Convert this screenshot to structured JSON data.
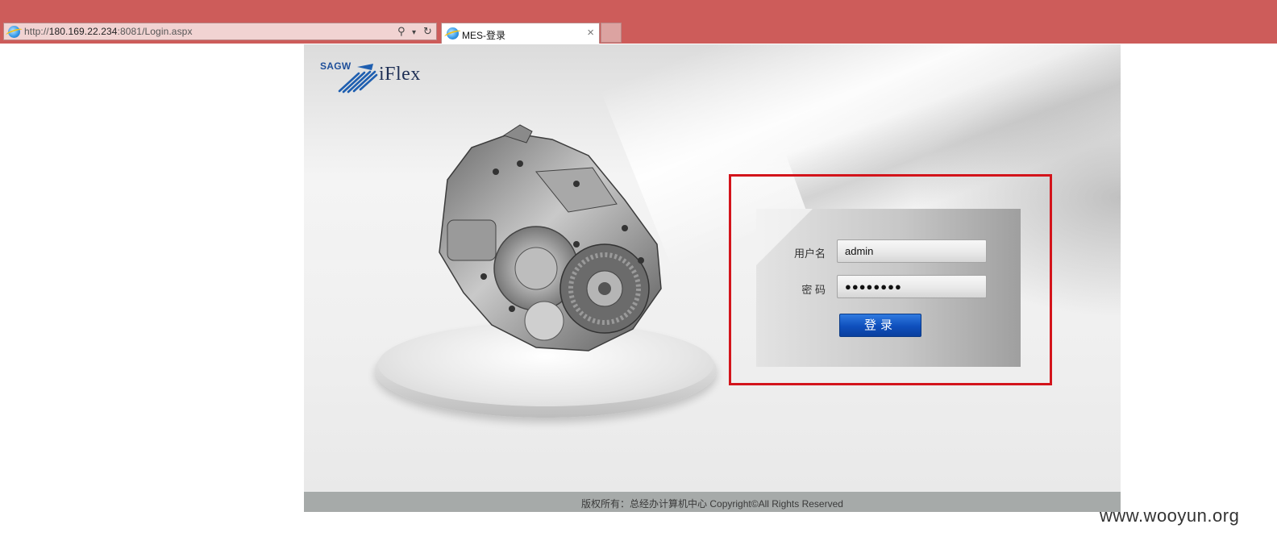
{
  "browser": {
    "url_prefix": "http://",
    "url_host": "180.169.22.234",
    "url_rest": ":8081/Login.aspx",
    "search_glyph": "⚲",
    "dropdown_glyph": "▾",
    "refresh_glyph": "↻",
    "tab_title": "MES-登录",
    "tab_close": "×"
  },
  "brand": {
    "company": "SAGW",
    "product": "iFlex"
  },
  "login": {
    "username_label": "用户名",
    "username_value": "admin",
    "password_label": "密 码",
    "password_value": "●●●●●●●●",
    "submit_label": "登录"
  },
  "footer": {
    "copyright": "版权所有：总经办计算机中心 Copyright©All Rights Reserved"
  },
  "watermark": "www.wooyun.org",
  "colors": {
    "chrome_bg": "#cd5c5a",
    "highlight_border": "#d3141b",
    "button_blue": "#0f4fbc",
    "footer_bg": "#a6aaa9"
  },
  "icons": [
    "ie-logo-icon",
    "search-icon",
    "dropdown-icon",
    "refresh-icon",
    "close-icon",
    "gearbox-image",
    "sagw-logo-icon"
  ]
}
